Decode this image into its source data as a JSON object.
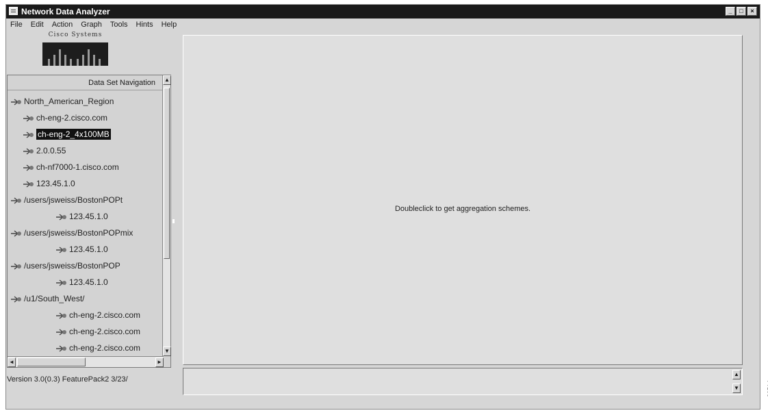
{
  "window": {
    "title": "Network Data Analyzer"
  },
  "menu": [
    "File",
    "Edit",
    "Action",
    "Graph",
    "Tools",
    "Hints",
    "Help"
  ],
  "logo": {
    "text": "Cisco Systems"
  },
  "nav": {
    "header": "Data Set Navigation",
    "items": [
      {
        "label": "North_American_Region",
        "indent": 0
      },
      {
        "label": "ch-eng-2.cisco.com",
        "indent": 1
      },
      {
        "label": "ch-eng-2_4x100MB",
        "indent": 1,
        "selected": true
      },
      {
        "label": "2.0.0.55",
        "indent": 1
      },
      {
        "label": "ch-nf7000-1.cisco.com",
        "indent": 1
      },
      {
        "label": "123.45.1.0",
        "indent": 1
      },
      {
        "label": "/users/jsweiss/BostonPOPt",
        "indent": 0
      },
      {
        "label": "123.45.1.0",
        "indent": 2
      },
      {
        "label": "/users/jsweiss/BostonPOPmix",
        "indent": 0
      },
      {
        "label": "123.45.1.0",
        "indent": 2
      },
      {
        "label": "/users/jsweiss/BostonPOP",
        "indent": 0
      },
      {
        "label": "123.45.1.0",
        "indent": 2
      },
      {
        "label": "/u1/South_West/",
        "indent": 0
      },
      {
        "label": "ch-eng-2.cisco.com",
        "indent": 2
      },
      {
        "label": "ch-eng-2.cisco.com",
        "indent": 2
      },
      {
        "label": "ch-eng-2.cisco.com",
        "indent": 2
      }
    ]
  },
  "main": {
    "hint": "Doubleclick to get aggregation schemes."
  },
  "status": {
    "version": "Version 3.0(0.3) FeaturePack2 3/23/"
  },
  "figure_id": "26514"
}
